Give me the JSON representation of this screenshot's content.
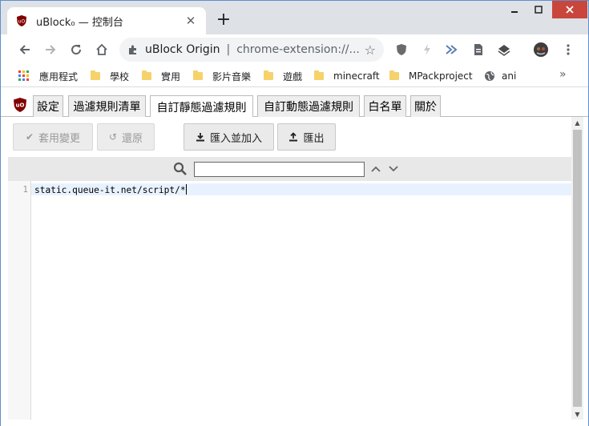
{
  "tab": {
    "title": "uBlock₀ — 控制台",
    "close_glyph": "✕"
  },
  "newtab_glyph": "+",
  "omnibox": {
    "site": "uBlock Origin",
    "separator": "|",
    "url": "chrome-extension://..."
  },
  "bookmarks": [
    {
      "label": "應用程式",
      "icon": "apps-icon"
    },
    {
      "label": "學校",
      "icon": "folder-icon"
    },
    {
      "label": "實用",
      "icon": "folder-icon"
    },
    {
      "label": "影片音樂",
      "icon": "folder-icon"
    },
    {
      "label": "遊戲",
      "icon": "folder-icon"
    },
    {
      "label": "minecraft",
      "icon": "folder-icon"
    },
    {
      "label": "MPackproject",
      "icon": "folder-icon"
    },
    {
      "label": "ani",
      "icon": "globe-icon"
    }
  ],
  "bookmarks_more": "»",
  "dashboard_tabs": [
    {
      "label": "設定",
      "active": false
    },
    {
      "label": "過濾規則清單",
      "active": false
    },
    {
      "label": "自訂靜態過濾規則",
      "active": true
    },
    {
      "label": "自訂動態過濾規則",
      "active": false
    },
    {
      "label": "白名單",
      "active": false
    },
    {
      "label": "關於",
      "active": false
    }
  ],
  "actions": {
    "apply": "套用變更",
    "revert": "還原",
    "import": "匯入並加入",
    "export": "匯出"
  },
  "search": {
    "value": ""
  },
  "editor": {
    "lines": [
      {
        "number": "1",
        "text": "static.queue-it.net/script/*"
      }
    ]
  },
  "colors": {
    "accent_ublock": "#800000",
    "window_border": "#5e8fcc",
    "close_button": "#c9463d"
  }
}
